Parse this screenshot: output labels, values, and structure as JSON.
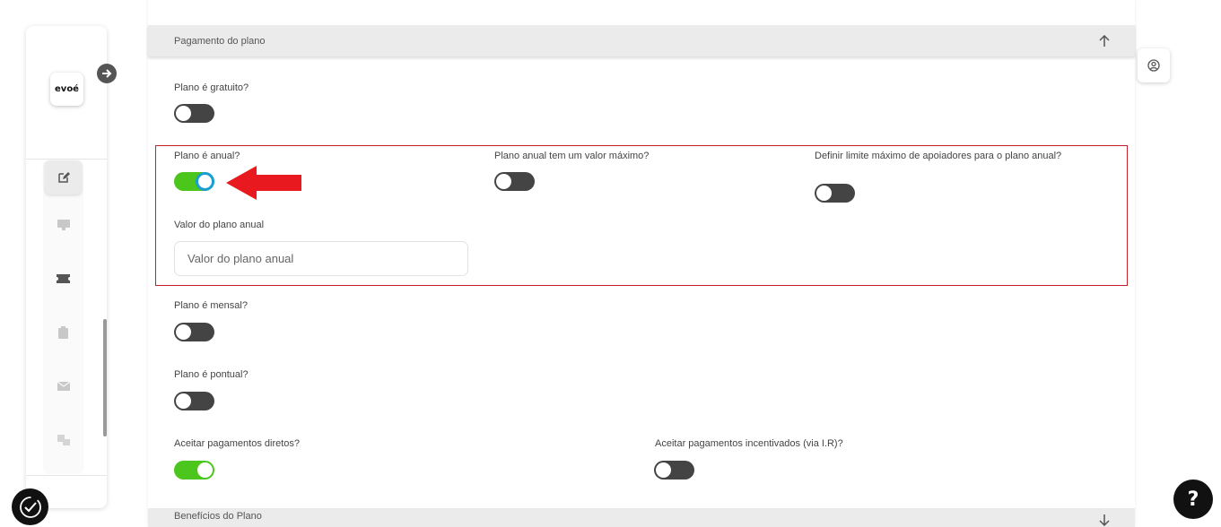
{
  "sidebar": {
    "logo_text": "evoé",
    "expand_icon": "arrow-right-icon",
    "items": [
      {
        "icon": "edit-icon",
        "active": true
      },
      {
        "icon": "monitor-icon",
        "active": false
      },
      {
        "icon": "ticket-icon",
        "active": false
      },
      {
        "icon": "clipboard-icon",
        "active": false
      },
      {
        "icon": "mail-icon",
        "active": false
      },
      {
        "icon": "users-icon",
        "active": false
      }
    ]
  },
  "section": {
    "title": "Pagamento do plano",
    "collapse_icon": "arrow-up-icon"
  },
  "fields": {
    "gratuito": {
      "label": "Plano é gratuito?",
      "on": false
    },
    "anual": {
      "label": "Plano é anual?",
      "on": true
    },
    "anual_max_valor": {
      "label": "Plano anual tem um valor máximo?",
      "on": false
    },
    "limite_apoiadores": {
      "label": "Definir limite máximo de apoiadores para o plano anual?",
      "on": false
    },
    "valor_anual": {
      "label": "Valor do plano anual",
      "placeholder": "Valor do plano anual",
      "value": ""
    },
    "mensal": {
      "label": "Plano é mensal?",
      "on": false
    },
    "pontual": {
      "label": "Plano é pontual?",
      "on": false
    },
    "pagamentos_diretos": {
      "label": "Aceitar pagamentos diretos?",
      "on": true
    },
    "pagamentos_incentivados": {
      "label": "Aceitar pagamentos incentivados (via I.R)?",
      "on": false
    }
  },
  "next_section": {
    "title": "Benefícios do Plano",
    "expand_icon": "arrow-down-icon"
  },
  "colors": {
    "toggle_on": "#4cc51d",
    "toggle_off": "#444444",
    "highlight_border": "#c8202a",
    "annotation_arrow": "#e8191f"
  },
  "help_button": {
    "label": "?"
  }
}
